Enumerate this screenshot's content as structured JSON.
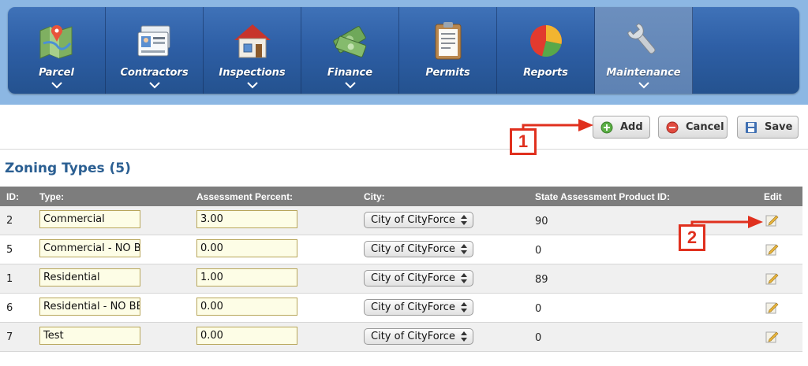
{
  "nav": {
    "items": [
      {
        "label": "Parcel",
        "icon": "map-pin-icon"
      },
      {
        "label": "Contractors",
        "icon": "id-card-icon"
      },
      {
        "label": "Inspections",
        "icon": "house-icon"
      },
      {
        "label": "Finance",
        "icon": "money-icon"
      },
      {
        "label": "Permits",
        "icon": "clipboard-icon"
      },
      {
        "label": "Reports",
        "icon": "pie-chart-icon"
      },
      {
        "label": "Maintenance",
        "icon": "wrench-icon"
      }
    ],
    "active": "Maintenance"
  },
  "toolbar": {
    "add_label": "Add",
    "cancel_label": "Cancel",
    "save_label": "Save"
  },
  "annotations": {
    "marker_1": "1",
    "marker_2": "2",
    "color": "#e0301e"
  },
  "section": {
    "title": "Zoning Types (5)"
  },
  "table": {
    "headers": {
      "id": "ID:",
      "type": "Type:",
      "assessment": "Assessment Percent:",
      "city": "City:",
      "state_id": "State Assessment Product ID:",
      "edit": "Edit"
    },
    "rows": [
      {
        "id": "2",
        "type": "Commercial",
        "assessment": "3.00",
        "city": "City of CityForce",
        "state_id": "90"
      },
      {
        "id": "5",
        "type": "Commercial - NO BBS",
        "assessment": "0.00",
        "city": "City of CityForce",
        "state_id": "0"
      },
      {
        "id": "1",
        "type": "Residential",
        "assessment": "1.00",
        "city": "City of CityForce",
        "state_id": "89"
      },
      {
        "id": "6",
        "type": "Residential - NO BBS",
        "assessment": "0.00",
        "city": "City of CityForce",
        "state_id": "0"
      },
      {
        "id": "7",
        "type": "Test",
        "assessment": "0.00",
        "city": "City of CityForce",
        "state_id": "0"
      }
    ]
  },
  "colors": {
    "nav_bg": "#2e5fa6",
    "header_bg": "#7d7d7d",
    "title": "#2b5f92",
    "input_bg": "#fdfde6"
  }
}
